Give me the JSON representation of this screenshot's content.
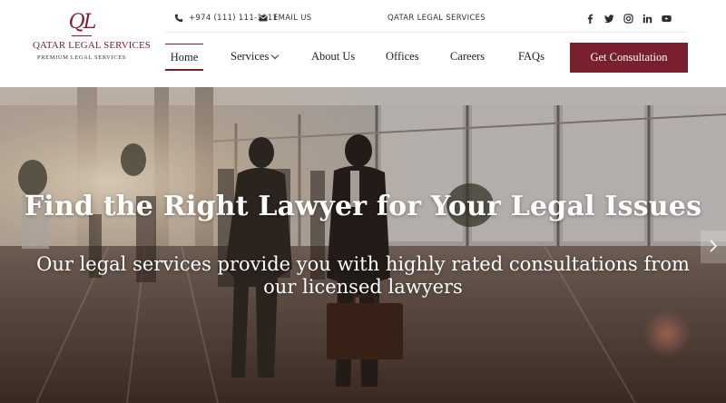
{
  "brand": {
    "monogram": "QL",
    "name": "QATAR LEGAL SERVICES",
    "tagline": "PREMIUM LEGAL SERVICES",
    "accent_color": "#7a1f2e"
  },
  "topbar": {
    "phone_icon": "phone-icon",
    "phone": "+974 (111) 111-1111",
    "email_icon": "envelope-icon",
    "email_label": "EMAIL US",
    "brand_text": "QATAR LEGAL SERVICES",
    "social": [
      "facebook-icon",
      "twitter-icon",
      "instagram-icon",
      "linkedin-icon",
      "youtube-icon"
    ]
  },
  "nav": {
    "home": "Home",
    "services": "Services",
    "about": "About Us",
    "offices": "Offices",
    "careers": "Careers",
    "faqs": "FAQs",
    "active": "Home",
    "cta": "Get Consultation"
  },
  "hero": {
    "title": "Find the Right Lawyer for Your Legal Issues",
    "subtitle": "Our legal services provide you with highly rated consultations from our licensed lawyers",
    "next_icon": "chevron-right-icon"
  }
}
